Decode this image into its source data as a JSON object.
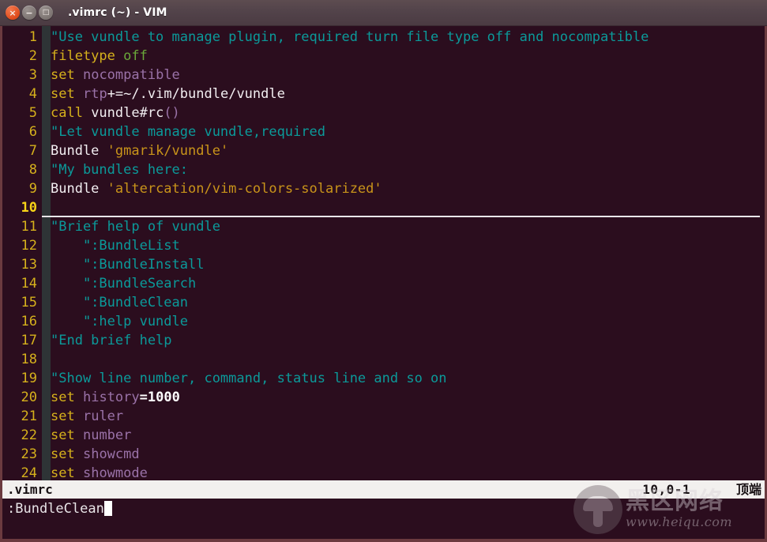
{
  "window": {
    "title": ".vimrc (~) - VIM",
    "controls": [
      {
        "name": "close",
        "glyph": "×"
      },
      {
        "name": "minimize",
        "glyph": "−"
      },
      {
        "name": "maximize",
        "glyph": "□"
      }
    ]
  },
  "editor": {
    "filename": ".vimrc",
    "cursor_line": 10,
    "lines": [
      {
        "n": "1",
        "segments": [
          {
            "cls": "cmt",
            "t": "\"Use vundle to manage plugin, required turn file type off and nocompatible"
          }
        ]
      },
      {
        "n": "2",
        "segments": [
          {
            "cls": "kw",
            "t": "filetype"
          },
          {
            "cls": "txt",
            "t": " "
          },
          {
            "cls": "grn",
            "t": "off"
          }
        ]
      },
      {
        "n": "3",
        "segments": [
          {
            "cls": "kw",
            "t": "set"
          },
          {
            "cls": "txt",
            "t": " "
          },
          {
            "cls": "opt",
            "t": "nocompatible"
          }
        ]
      },
      {
        "n": "4",
        "segments": [
          {
            "cls": "kw",
            "t": "set"
          },
          {
            "cls": "txt",
            "t": " "
          },
          {
            "cls": "opt",
            "t": "rtp"
          },
          {
            "cls": "txt",
            "t": "+=~/.vim/bundle/vundle"
          }
        ]
      },
      {
        "n": "5",
        "segments": [
          {
            "cls": "kw",
            "t": "call"
          },
          {
            "cls": "txt",
            "t": " vundle#rc"
          },
          {
            "cls": "paren",
            "t": "()"
          }
        ]
      },
      {
        "n": "6",
        "segments": [
          {
            "cls": "cmt",
            "t": "\"Let vundle manage vundle,required"
          }
        ]
      },
      {
        "n": "7",
        "segments": [
          {
            "cls": "txt",
            "t": "Bundle "
          },
          {
            "cls": "str",
            "t": "'gmarik/vundle'"
          }
        ]
      },
      {
        "n": "8",
        "segments": [
          {
            "cls": "cmt",
            "t": "\"My bundles here:"
          }
        ]
      },
      {
        "n": "9",
        "segments": [
          {
            "cls": "txt",
            "t": "Bundle "
          },
          {
            "cls": "str",
            "t": "'altercation/vim-colors-solarized'"
          }
        ]
      },
      {
        "n": "10",
        "segments": [
          {
            "cls": "txt",
            "t": ""
          }
        ]
      },
      {
        "n": "11",
        "segments": [
          {
            "cls": "cmt",
            "t": "\"Brief help of vundle"
          }
        ]
      },
      {
        "n": "12",
        "segments": [
          {
            "cls": "cmt",
            "t": "    \":BundleList"
          }
        ]
      },
      {
        "n": "13",
        "segments": [
          {
            "cls": "cmt",
            "t": "    \":BundleInstall"
          }
        ]
      },
      {
        "n": "14",
        "segments": [
          {
            "cls": "cmt",
            "t": "    \":BundleSearch"
          }
        ]
      },
      {
        "n": "15",
        "segments": [
          {
            "cls": "cmt",
            "t": "    \":BundleClean"
          }
        ]
      },
      {
        "n": "16",
        "segments": [
          {
            "cls": "cmt",
            "t": "    \":help vundle"
          }
        ]
      },
      {
        "n": "17",
        "segments": [
          {
            "cls": "cmt",
            "t": "\"End brief help"
          }
        ]
      },
      {
        "n": "18",
        "segments": [
          {
            "cls": "txt",
            "t": ""
          }
        ]
      },
      {
        "n": "19",
        "segments": [
          {
            "cls": "cmt",
            "t": "\"Show line number, command, status line and so on"
          }
        ]
      },
      {
        "n": "20",
        "segments": [
          {
            "cls": "kw",
            "t": "set"
          },
          {
            "cls": "txt",
            "t": " "
          },
          {
            "cls": "opt",
            "t": "history"
          },
          {
            "cls": "num",
            "t": "=1000"
          }
        ]
      },
      {
        "n": "21",
        "segments": [
          {
            "cls": "kw",
            "t": "set"
          },
          {
            "cls": "txt",
            "t": " "
          },
          {
            "cls": "opt",
            "t": "ruler"
          }
        ]
      },
      {
        "n": "22",
        "segments": [
          {
            "cls": "kw",
            "t": "set"
          },
          {
            "cls": "txt",
            "t": " "
          },
          {
            "cls": "opt",
            "t": "number"
          }
        ]
      },
      {
        "n": "23",
        "segments": [
          {
            "cls": "kw",
            "t": "set"
          },
          {
            "cls": "txt",
            "t": " "
          },
          {
            "cls": "opt",
            "t": "showcmd"
          }
        ]
      },
      {
        "n": "24",
        "segments": [
          {
            "cls": "kw",
            "t": "set"
          },
          {
            "cls": "txt",
            "t": " "
          },
          {
            "cls": "opt",
            "t": "showmode"
          }
        ]
      }
    ]
  },
  "statusline": {
    "file": ".vimrc",
    "position": "10,0-1",
    "scroll": "顶端"
  },
  "commandline": {
    "text": ":BundleClean"
  },
  "watermark": {
    "cn": "黑区网络",
    "url": "www.heiqu.com"
  },
  "colors": {
    "background": "#2b0d1e",
    "comment": "#0b9a9a",
    "keyword": "#d6b11c",
    "option": "#9a72a8",
    "string": "#c9941a",
    "text": "#f2eef1",
    "linenr": "#d6b11c",
    "statusbar_bg": "#f2f0ee",
    "frame": "#6b3a3f"
  }
}
